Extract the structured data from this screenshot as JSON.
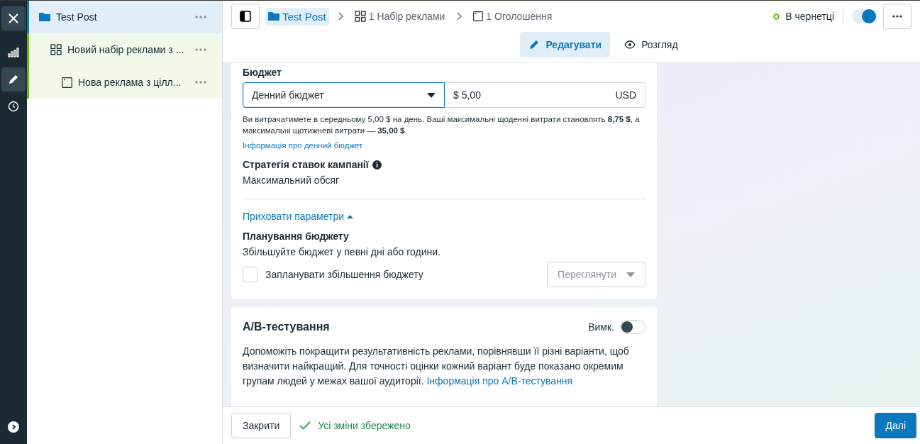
{
  "rail": {
    "items": [
      {
        "kind": "chart",
        "selected": false
      },
      {
        "kind": "edit",
        "selected": true
      },
      {
        "kind": "history",
        "selected": false
      }
    ]
  },
  "tree": [
    {
      "kind": "campaign",
      "label": "Test Post",
      "selected": true,
      "children": [
        {
          "kind": "adset",
          "label": "Новий набір реклами з ...",
          "selected": false,
          "children": [
            {
              "kind": "ad",
              "label": "Нова реклама з цілл...",
              "selected": false
            }
          ]
        }
      ]
    }
  ],
  "breadcrumb": [
    {
      "kind": "campaign",
      "label": "Test Post",
      "selected": true
    },
    {
      "kind": "adset",
      "label": "1 Набір реклами",
      "selected": false
    },
    {
      "kind": "ad",
      "label": "1 Оголошення",
      "selected": false
    }
  ],
  "status": {
    "label": "В чернетці",
    "color": "#5fb71b",
    "on": true
  },
  "modes": [
    {
      "kind": "edit",
      "label": "Редагувати",
      "selected": true
    },
    {
      "kind": "view",
      "label": "Розгляд",
      "selected": false
    }
  ],
  "budget": {
    "title": "Бюджет",
    "type": "Денний бюджет",
    "amount": "$ 5,00",
    "currency": "USD",
    "note": "Ви витрачатимете в середньому 5,00 $ на день. Ваші максимальні щоденні витрати становлять **8,75 $**, а максимальні щотижневі витрати — **35,00 $**.",
    "link": "Інформація про денний бюджет",
    "strategy_title": "Стратегія ставок кампанії",
    "strategy": "Максимальний обсяг",
    "toggle_link": "Приховати параметри",
    "expanded": true,
    "schedule_title": "Планування бюджету",
    "schedule_text": "Збільшуйте бюджет у певні дні або години.",
    "schedule_checkbox": {
      "label": "Запланувати збільшення бюджету",
      "checked": false
    },
    "preview_button": "Переглянути"
  },
  "ab_test": {
    "title": "A/B-тестування",
    "toggle_label": "Вимк.",
    "on": false,
    "text": "Допоможіть покращити результативність реклами, порівнявши її різні варіанти, щоб визначити найкращий. Для точності оцінки кожний варіант буде показано окремим групам людей у межах вашої аудиторії.",
    "link": "Інформація про A/B-тестування"
  },
  "footer": {
    "close": "Закрити",
    "saved": "Усі зміни збережено",
    "next": "Далі"
  }
}
